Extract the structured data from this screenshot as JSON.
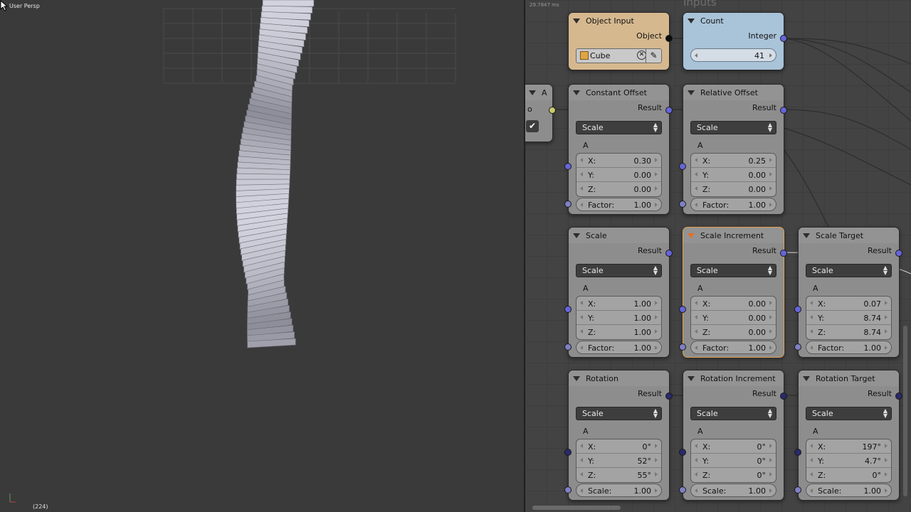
{
  "viewport": {
    "title": "User Persp",
    "frame": "(224)"
  },
  "node_editor": {
    "timing": "29.7847 ms",
    "frame_label": "Inputs",
    "nodes": {
      "object_input": {
        "title": "Object Input",
        "output": "Object",
        "object_name": "Cube"
      },
      "count": {
        "title": "Count",
        "output": "Integer",
        "value": "41"
      },
      "a": {
        "title": "A",
        "output": "o"
      },
      "constant_offset": {
        "title": "Constant Offset",
        "output": "Result",
        "mode": "Scale",
        "vector_label": "A",
        "x": "0.30",
        "y": "0.00",
        "z": "0.00",
        "factor_label": "Factor:",
        "factor": "1.00"
      },
      "relative_offset": {
        "title": "Relative Offset",
        "output": "Result",
        "mode": "Scale",
        "vector_label": "A",
        "x": "0.25",
        "y": "0.00",
        "z": "0.00",
        "factor_label": "Factor:",
        "factor": "1.00"
      },
      "scale": {
        "title": "Scale",
        "output": "Result",
        "mode": "Scale",
        "vector_label": "A",
        "x": "1.00",
        "y": "1.00",
        "z": "1.00",
        "factor_label": "Factor:",
        "factor": "1.00"
      },
      "scale_increment": {
        "title": "Scale Increment",
        "output": "Result",
        "mode": "Scale",
        "vector_label": "A",
        "x": "0.00",
        "y": "0.00",
        "z": "0.00",
        "factor_label": "Factor:",
        "factor": "1.00"
      },
      "scale_target": {
        "title": "Scale Target",
        "output": "Result",
        "mode": "Scale",
        "vector_label": "A",
        "x": "0.07",
        "y": "8.74",
        "z": "8.74",
        "factor_label": "Factor:",
        "factor": "1.00"
      },
      "rotation": {
        "title": "Rotation",
        "output": "Result",
        "mode": "Scale",
        "vector_label": "A",
        "x": "0°",
        "y": "52°",
        "z": "55°",
        "factor_label": "Scale:",
        "factor": "1.00"
      },
      "rotation_increment": {
        "title": "Rotation Increment",
        "output": "Result",
        "mode": "Scale",
        "vector_label": "A",
        "x": "0°",
        "y": "0°",
        "z": "0°",
        "factor_label": "Scale:",
        "factor": "1.00"
      },
      "rotation_target": {
        "title": "Rotation Target",
        "output": "Result",
        "mode": "Scale",
        "vector_label": "A",
        "x": "197°",
        "y": "4.7°",
        "z": "0°",
        "factor_label": "Scale:",
        "factor": "1.00"
      }
    },
    "axis_labels": {
      "x": "X:",
      "y": "Y:",
      "z": "Z:"
    }
  },
  "colors": {
    "object_node": "#d6b88f",
    "count_node": "#a9c3d8",
    "selected_outline": "#e3a24e"
  }
}
